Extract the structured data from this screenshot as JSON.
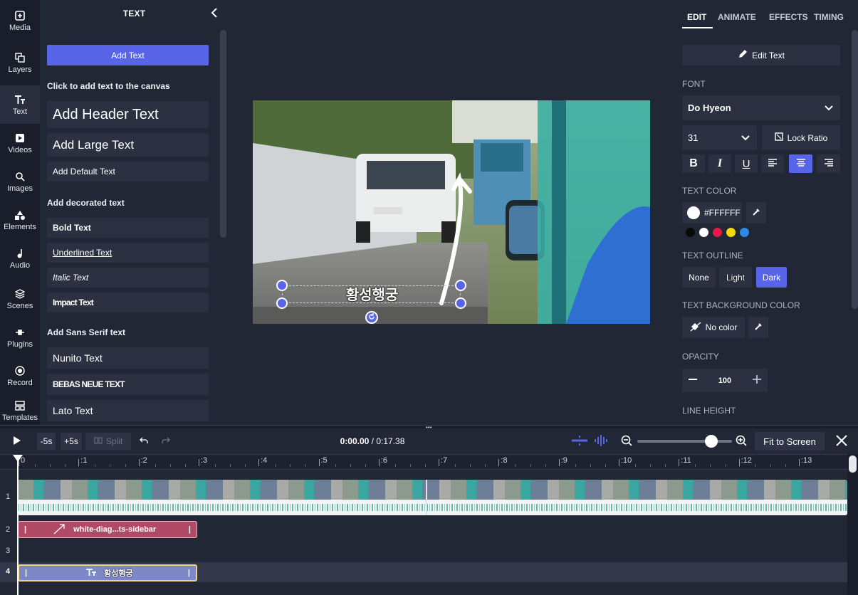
{
  "rail": [
    {
      "label": "Media",
      "icon": "media-icon"
    },
    {
      "label": "Layers",
      "icon": "layers-icon"
    },
    {
      "label": "Text",
      "icon": "text-icon"
    },
    {
      "label": "Videos",
      "icon": "videos-icon"
    },
    {
      "label": "Images",
      "icon": "images-icon"
    },
    {
      "label": "Elements",
      "icon": "elements-icon"
    },
    {
      "label": "Audio",
      "icon": "audio-icon"
    },
    {
      "label": "Scenes",
      "icon": "scenes-icon"
    },
    {
      "label": "Plugins",
      "icon": "plugins-icon"
    },
    {
      "label": "Record",
      "icon": "record-icon"
    },
    {
      "label": "Templates",
      "icon": "templates-icon"
    }
  ],
  "panel": {
    "title": "TEXT",
    "add_text": "Add Text",
    "hint": "Click to add text to the canvas",
    "header": "Add Header Text",
    "large": "Add Large Text",
    "default": "Add Default Text",
    "decorated_title": "Add decorated text",
    "bold": "Bold Text",
    "underlined": "Underlined Text",
    "italic": "Italic Text",
    "impact": "Impact Text",
    "sans_title": "Add Sans Serif text",
    "nunito": "Nunito Text",
    "bebas": "BEBAS NEUE TEXT",
    "lato": "Lato Text"
  },
  "canvas": {
    "text": "황성행궁"
  },
  "props": {
    "tabs": [
      "EDIT",
      "ANIMATE",
      "EFFECTS",
      "TIMING"
    ],
    "edit_text": "Edit Text",
    "font_label": "FONT",
    "font": "Do Hyeon",
    "size": "31",
    "lock_ratio": "Lock Ratio",
    "text_color_label": "TEXT COLOR",
    "text_color": "#FFFFFF",
    "swatches": [
      "#0a0a0a",
      "#ffffff",
      "#e8194a",
      "#f5d90a",
      "#2b8be6"
    ],
    "outline_label": "TEXT OUTLINE",
    "outline": [
      "None",
      "Light",
      "Dark"
    ],
    "bg_label": "TEXT BACKGROUND COLOR",
    "no_color": "No color",
    "opacity_label": "OPACITY",
    "opacity": "100",
    "line_height_label": "LINE HEIGHT"
  },
  "timeline": {
    "minus5": "-5s",
    "plus5": "+5s",
    "split": "Split",
    "current": "0:00.00",
    "sep": " / ",
    "duration": "0:17.38",
    "fit": "Fit to Screen",
    "zoom_level": 0.78,
    "ticks": [
      "0",
      ":1",
      ":2",
      ":3",
      ":4",
      ":5",
      ":6",
      ":7",
      ":8",
      ":9",
      ":10",
      ":11",
      ":12",
      ":13"
    ],
    "tracks": [
      "1",
      "2",
      "3",
      "4"
    ],
    "clip2": "white-diag...ts-sidebar",
    "clip4": "황성행궁"
  }
}
